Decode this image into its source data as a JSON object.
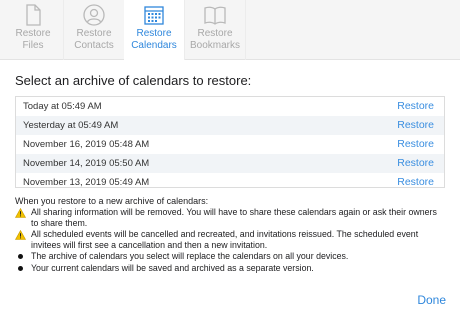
{
  "toolbar": {
    "tabs": [
      {
        "label": "Restore\nFiles",
        "line1": "Restore",
        "line2": "Files",
        "icon": "document-icon",
        "active": false
      },
      {
        "label": "Restore Contacts",
        "line1": "Restore",
        "line2": "Contacts",
        "icon": "contact-icon",
        "active": false
      },
      {
        "label": "Restore Calendars",
        "line1": "Restore",
        "line2": "Calendars",
        "icon": "calendar-icon",
        "active": true
      },
      {
        "label": "Restore Bookmarks",
        "line1": "Restore",
        "line2": "Bookmarks",
        "icon": "book-icon",
        "active": false
      }
    ]
  },
  "main": {
    "heading": "Select an archive of calendars to restore:",
    "archives": [
      {
        "date": "Today at 05:49 AM",
        "action": "Restore"
      },
      {
        "date": "Yesterday at 05:49 AM",
        "action": "Restore"
      },
      {
        "date": "November 16, 2019 05:48 AM",
        "action": "Restore"
      },
      {
        "date": "November 14, 2019 05:50 AM",
        "action": "Restore"
      },
      {
        "date": "November 13, 2019 05:49 AM",
        "action": "Restore"
      }
    ]
  },
  "info": {
    "title": "When you restore to a new archive of calendars:",
    "notes": [
      {
        "type": "warning",
        "text": "All sharing information will be removed. You will have to share these calendars again or ask their owners to share them."
      },
      {
        "type": "warning",
        "text": "All scheduled events will be cancelled and recreated, and invitations reissued. The scheduled event invitees will first see a cancellation and then a new invitation."
      },
      {
        "type": "bullet",
        "text": "The archive of calendars you select will replace the calendars on all your devices."
      },
      {
        "type": "bullet",
        "text": "Your current calendars will be saved and archived as a separate version."
      }
    ]
  },
  "footer": {
    "done_label": "Done"
  },
  "colors": {
    "accent": "#2f87dc",
    "warning": "#f2c200"
  }
}
